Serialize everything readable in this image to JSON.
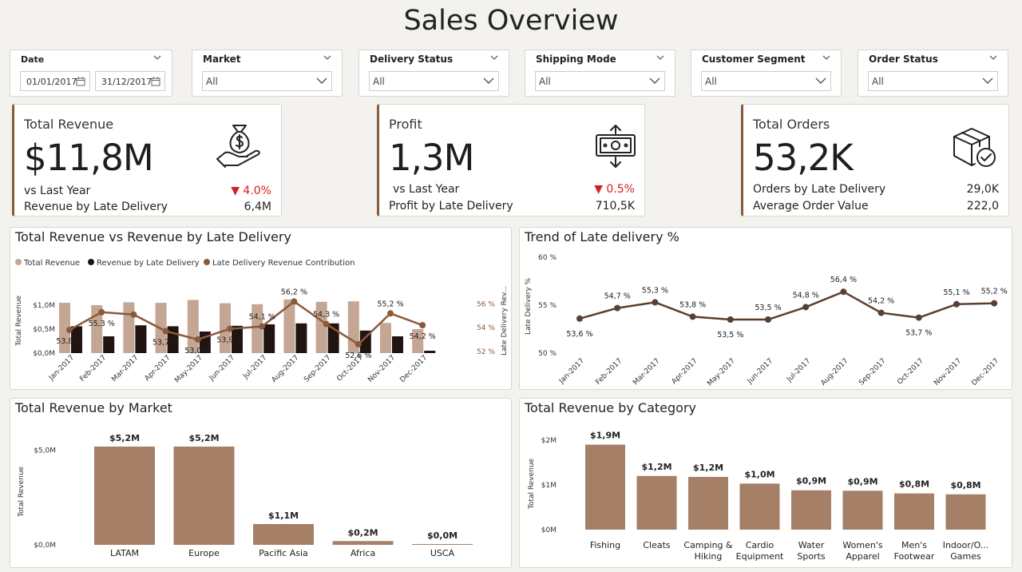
{
  "page": {
    "title": "Sales Overview"
  },
  "filters": {
    "date": {
      "label": "Date",
      "from": "01/01/2017",
      "to": "31/12/2017"
    },
    "market": {
      "label": "Market",
      "value": "All"
    },
    "delivery_status": {
      "label": "Delivery Status",
      "value": "All"
    },
    "shipping_mode": {
      "label": "Shipping Mode",
      "value": "All"
    },
    "customer_segment": {
      "label": "Customer Segment",
      "value": "All"
    },
    "order_status": {
      "label": "Order Status",
      "value": "All"
    }
  },
  "kpis": {
    "revenue": {
      "title": "Total Revenue",
      "value": "$11,8M",
      "vs_label": "vs Last Year",
      "vs_value": "4.0%",
      "late_label": "Revenue by Late Delivery",
      "late_value": "6,4M",
      "icon": "money-bag-hand-icon"
    },
    "profit": {
      "title": "Profit",
      "value": "1,3M",
      "vs_label": "vs Last Year",
      "vs_value": "0.5%",
      "late_label": "Profit by Late Delivery",
      "late_value": "710,5K",
      "icon": "cash-transfer-icon"
    },
    "orders": {
      "title": "Total Orders",
      "value": "53,2K",
      "row1_label": "Orders by Late Delivery",
      "row1_value": "29,0K",
      "row2_label": "Average Order Value",
      "row2_value": "222,0",
      "icon": "box-check-icon"
    }
  },
  "colors": {
    "accent": "#8a5a3c",
    "bar_light": "#c4a692",
    "bar_dark": "#1f1410",
    "line": "#8a5a3c",
    "trend_line": "#5a3f30",
    "category_bar": "#a58066",
    "negative": "#d61f1f"
  },
  "chart_data": [
    {
      "id": "revenue-vs-late",
      "type": "bar",
      "title": "Total Revenue vs Revenue by Late Delivery",
      "ylabel": "Total Revenue",
      "y2label": "Late Delivery Rev...",
      "categories": [
        "Jan-2017",
        "Feb-2017",
        "Mar-2017",
        "Apr-2017",
        "May-2017",
        "Jun-2017",
        "Jul-2017",
        "Aug-2017",
        "Sep-2017",
        "Oct-2017",
        "Nov-2017",
        "Dec-2017"
      ],
      "ylim": [
        0,
        1.2
      ],
      "yticks": [
        "$0,0M",
        "$0,5M",
        "$1,0M"
      ],
      "y2lim": [
        51.85,
        56.7
      ],
      "y2ticks": [
        "52 %",
        "54 %",
        "56 %"
      ],
      "series": [
        {
          "name": "Total Revenue",
          "type": "bar",
          "values": [
            1.05,
            1.0,
            1.06,
            1.05,
            1.11,
            1.04,
            1.02,
            1.12,
            1.07,
            1.08,
            0.63,
            0.5
          ]
        },
        {
          "name": "Revenue by Late Delivery",
          "type": "bar",
          "values": [
            0.56,
            0.35,
            0.58,
            0.56,
            0.45,
            0.57,
            0.6,
            0.62,
            0.62,
            0.47,
            0.35,
            0.05
          ]
        },
        {
          "name": "Late Delivery Revenue Contribution",
          "type": "line",
          "values": [
            53.8,
            55.3,
            55.1,
            53.7,
            53.0,
            53.9,
            54.1,
            56.2,
            54.3,
            52.6,
            55.2,
            54.2
          ],
          "labels": [
            "53,8 %",
            "55,3 %",
            "",
            "53,7 %",
            "53,0 %",
            "53,9 %",
            "54,1 %",
            "56,2 %",
            "54,3 %",
            "52,6 %",
            "55,2 %",
            "54,2 %"
          ]
        }
      ]
    },
    {
      "id": "late-trend",
      "type": "line",
      "title": "Trend of Late delivery %",
      "ylabel": "Late Delivery %",
      "categories": [
        "Jan-2017",
        "Feb-2017",
        "Mar-2017",
        "Apr-2017",
        "May-2017",
        "Jun-2017",
        "Jul-2017",
        "Aug-2017",
        "Sep-2017",
        "Oct-2017",
        "Nov-2017",
        "Dec-2017"
      ],
      "ylim": [
        50,
        60
      ],
      "yticks": [
        "50 %",
        "55 %",
        "60 %"
      ],
      "values": [
        53.6,
        54.7,
        55.3,
        53.8,
        53.5,
        53.5,
        54.8,
        56.4,
        54.2,
        53.7,
        55.1,
        55.2
      ],
      "labels": [
        "53,6 %",
        "54,7 %",
        "55,3 %",
        "53,8 %",
        "53,5 %",
        "53,5 %",
        "54,8 %",
        "56,4 %",
        "54,2 %",
        "53,7 %",
        "55,1 %",
        "55,2 %"
      ]
    },
    {
      "id": "revenue-by-market",
      "type": "bar",
      "title": "Total Revenue by Market",
      "ylabel": "Total Revenue",
      "categories": [
        "LATAM",
        "Europe",
        "Pacific Asia",
        "Africa",
        "USCA"
      ],
      "values": [
        5.2,
        5.2,
        1.1,
        0.2,
        0.0
      ],
      "labels": [
        "$5,2M",
        "$5,2M",
        "$1,1M",
        "$0,2M",
        "$0,0M"
      ],
      "ylim": [
        0,
        5.2
      ],
      "yticks": [
        "$0,0M",
        "$5,0M"
      ]
    },
    {
      "id": "revenue-by-category",
      "type": "bar",
      "title": "Total Revenue by Category",
      "ylabel": "Total Revenue",
      "categories": [
        [
          "Fishing"
        ],
        [
          "Cleats"
        ],
        [
          "Camping &",
          "Hiking"
        ],
        [
          "Cardio",
          "Equipment"
        ],
        [
          "Water",
          "Sports"
        ],
        [
          "Women's",
          "Apparel"
        ],
        [
          "Men's",
          "Footwear"
        ],
        [
          "Indoor/O...",
          "Games"
        ]
      ],
      "values": [
        1.9,
        1.2,
        1.18,
        1.03,
        0.88,
        0.87,
        0.81,
        0.79
      ],
      "labels": [
        "$1,9M",
        "$1,2M",
        "$1,2M",
        "$1,0M",
        "$0,9M",
        "$0,9M",
        "$0,8M",
        "$0,8M"
      ],
      "ylim": [
        0,
        2
      ],
      "yticks": [
        "$0M",
        "$1M",
        "$2M"
      ]
    }
  ]
}
